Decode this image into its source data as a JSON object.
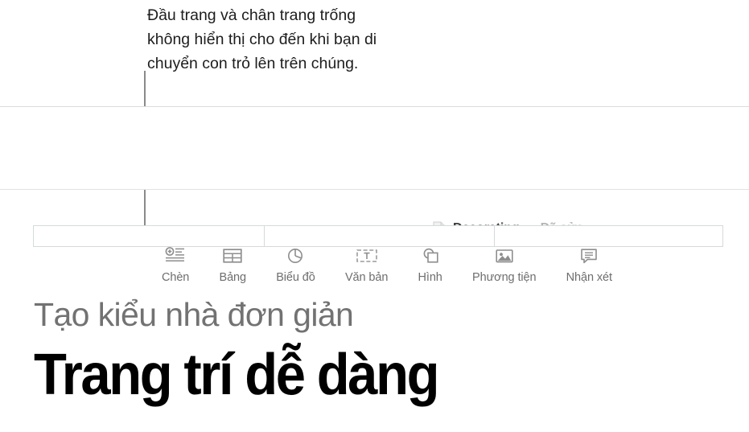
{
  "annotation": {
    "callout_text": "Đầu trang và chân trang trống\nkhông hiển thị cho đến khi bạn di\nchuyển con trỏ lên trên chúng.",
    "line_color": "#8a8a8a"
  },
  "titlebar": {
    "doc_icon": "pages-document-icon",
    "document_name": "Decorating",
    "separator": "—",
    "status": "Đã sửa",
    "title_color": "#3c3c3c",
    "status_color": "#b4b4b4"
  },
  "toolbar": {
    "items": [
      {
        "label": "Chèn",
        "icon": "insert-icon"
      },
      {
        "label": "Bảng",
        "icon": "table-icon"
      },
      {
        "label": "Biểu đồ",
        "icon": "chart-icon"
      },
      {
        "label": "Văn bản",
        "icon": "text-box-icon"
      },
      {
        "label": "Hình",
        "icon": "shape-icon"
      },
      {
        "label": "Phương tiện",
        "icon": "media-icon"
      },
      {
        "label": "Nhận xét",
        "icon": "comment-icon"
      }
    ],
    "label_color": "#6e6e6e",
    "icon_color": "#8e8e8e"
  },
  "header_area": {
    "fields": [
      {
        "value": "",
        "placeholder": ""
      },
      {
        "value": "",
        "placeholder": ""
      },
      {
        "value": "",
        "placeholder": ""
      }
    ],
    "border_color": "#d6dada"
  },
  "document": {
    "subtitle": "Tạo kiểu nhà đơn giản",
    "subtitle_color": "#727272",
    "heading": "Trang trí dễ dàng",
    "heading_color": "#000000"
  }
}
